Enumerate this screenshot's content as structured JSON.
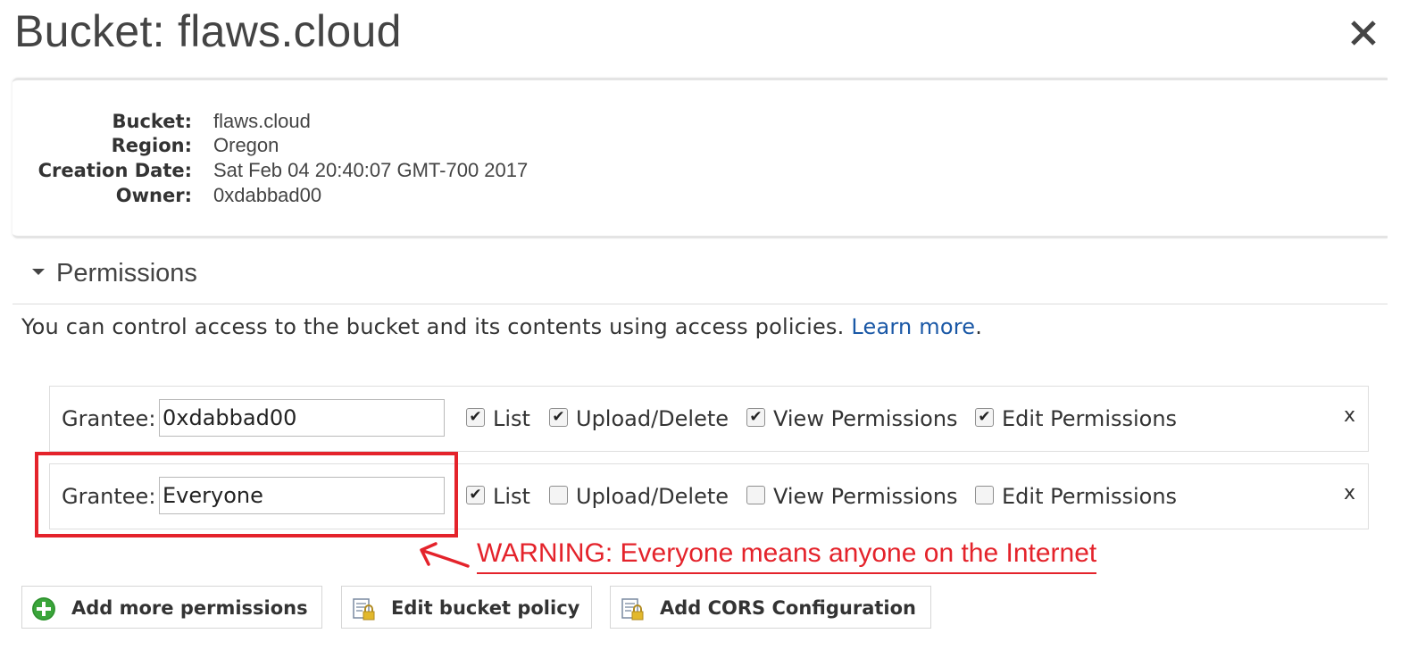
{
  "dialog": {
    "title": "Bucket: flaws.cloud",
    "close_icon": "close-icon"
  },
  "bucket_info": [
    {
      "label": "Bucket:",
      "value": "flaws.cloud"
    },
    {
      "label": "Region:",
      "value": "Oregon"
    },
    {
      "label": "Creation Date:",
      "value": "Sat Feb 04 20:40:07 GMT-700 2017"
    },
    {
      "label": "Owner:",
      "value": "0xdabbad00"
    }
  ],
  "permissions": {
    "header": "Permissions",
    "expanded": true,
    "description": "You can control access to the bucket and its contents using access policies.",
    "learn_more": "Learn more",
    "description_end": ".",
    "grantee_label": "Grantee:",
    "remove_label": "x",
    "grants": [
      {
        "grantee": "0xdabbad00",
        "list": {
          "label": "List",
          "checked": true
        },
        "upload_delete": {
          "label": "Upload/Delete",
          "checked": true
        },
        "view_permissions": {
          "label": "View Permissions",
          "checked": true
        },
        "edit_permissions": {
          "label": "Edit Permissions",
          "checked": true
        }
      },
      {
        "grantee": "Everyone",
        "list": {
          "label": "List",
          "checked": true
        },
        "upload_delete": {
          "label": "Upload/Delete",
          "checked": false
        },
        "view_permissions": {
          "label": "View Permissions",
          "checked": false
        },
        "edit_permissions": {
          "label": "Edit Permissions",
          "checked": false
        }
      }
    ]
  },
  "annotation": {
    "warning": "WARNING: Everyone means anyone on the Internet",
    "color": "#e4232b"
  },
  "actions": {
    "add_permissions": {
      "label": "Add more permissions",
      "icon": "plus-circle-icon"
    },
    "edit_policy": {
      "label": "Edit bucket policy",
      "icon": "document-lock-icon"
    },
    "add_cors": {
      "label": "Add CORS Configuration",
      "icon": "document-lock-icon"
    }
  },
  "colors": {
    "link": "#1a58a6",
    "add_icon": "#3aa53a"
  }
}
